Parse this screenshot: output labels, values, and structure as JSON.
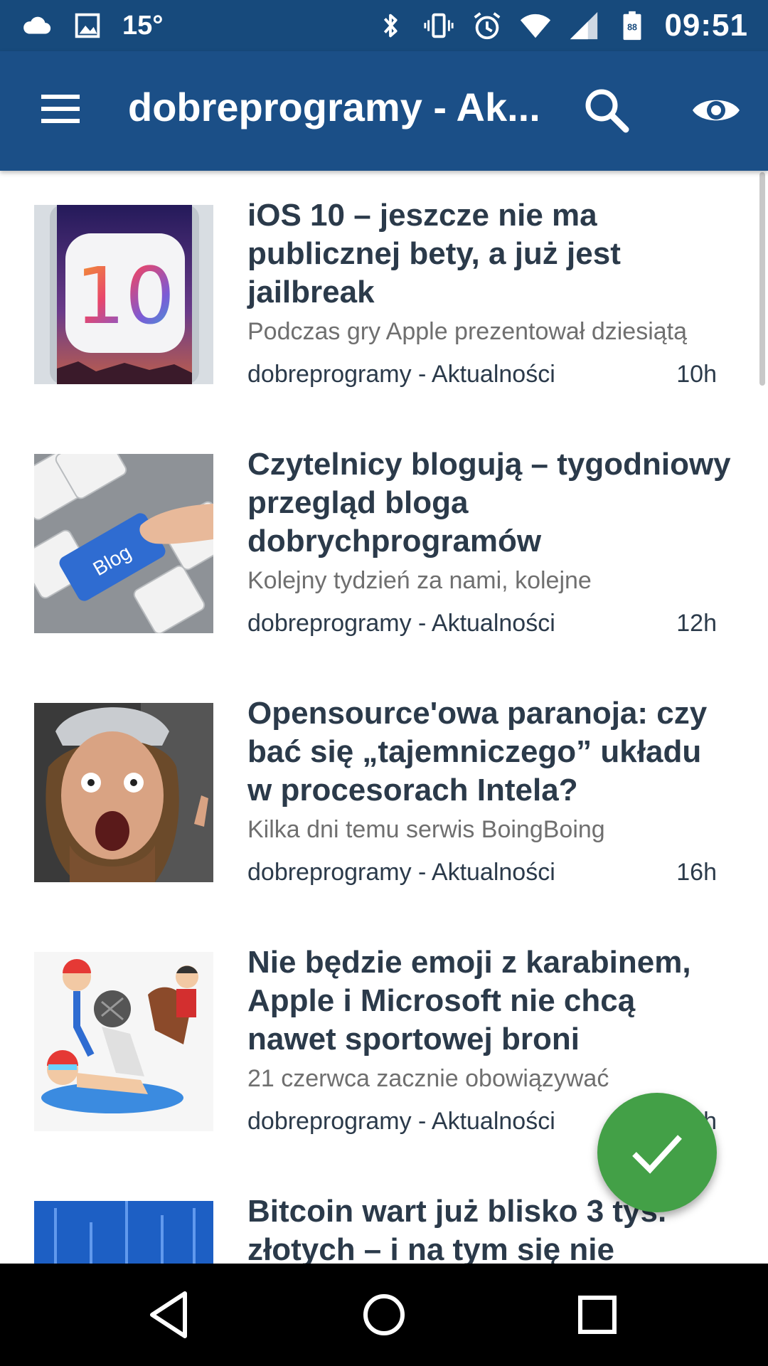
{
  "status_bar": {
    "temperature": "15°",
    "time": "09:51",
    "battery": "88",
    "icons": [
      "cloud-icon",
      "image-icon",
      "bluetooth-icon",
      "vibrate-icon",
      "alarm-icon",
      "wifi-icon",
      "signal-icon",
      "battery-icon"
    ]
  },
  "toolbar": {
    "title": "dobreprogramy - Ak...",
    "icons": [
      "menu-icon",
      "search-icon",
      "eye-icon"
    ]
  },
  "articles": [
    {
      "title": "iOS 10 – jeszcze nie ma publicznej bety, a już jest jailbreak",
      "description": "Podczas gry Apple prezentował dziesiątą",
      "source": "dobreprogramy - Aktualności",
      "age": "10h",
      "thumbnail_text": "10"
    },
    {
      "title": "Czytelnicy blogują – tygodniowy przegląd bloga dobrychprogramów",
      "description": "Kolejny tydzień za nami, kolejne",
      "source": "dobreprogramy - Aktualności",
      "age": "12h",
      "thumbnail_text": "Blog"
    },
    {
      "title": "Opensource'owa paranoja: czy bać się „tajemniczego” układu w procesorach Intela?",
      "description": "Kilka dni temu serwis BoingBoing",
      "source": "dobreprogramy - Aktualności",
      "age": "16h"
    },
    {
      "title": "Nie będzie emoji z karabinem, Apple i Microsoft nie chcą nawet sportowej broni",
      "description": "21 czerwca zacznie obowiązywać",
      "source": "dobreprogramy - Aktualności",
      "age": "h"
    },
    {
      "title": "Bitcoin wart już blisko 3 tys. złotych – i na tym się nie",
      "description": "",
      "source": "",
      "age": ""
    }
  ],
  "fab": {
    "icon": "check-icon"
  },
  "nav_bar": {
    "icons": [
      "back-icon",
      "home-icon",
      "recents-icon"
    ]
  },
  "colors": {
    "status_bar": "#174a7c",
    "toolbar": "#1b4f87",
    "fab": "#43a047",
    "title_text": "#2b3a4a",
    "description_text": "#6f6f6f"
  }
}
